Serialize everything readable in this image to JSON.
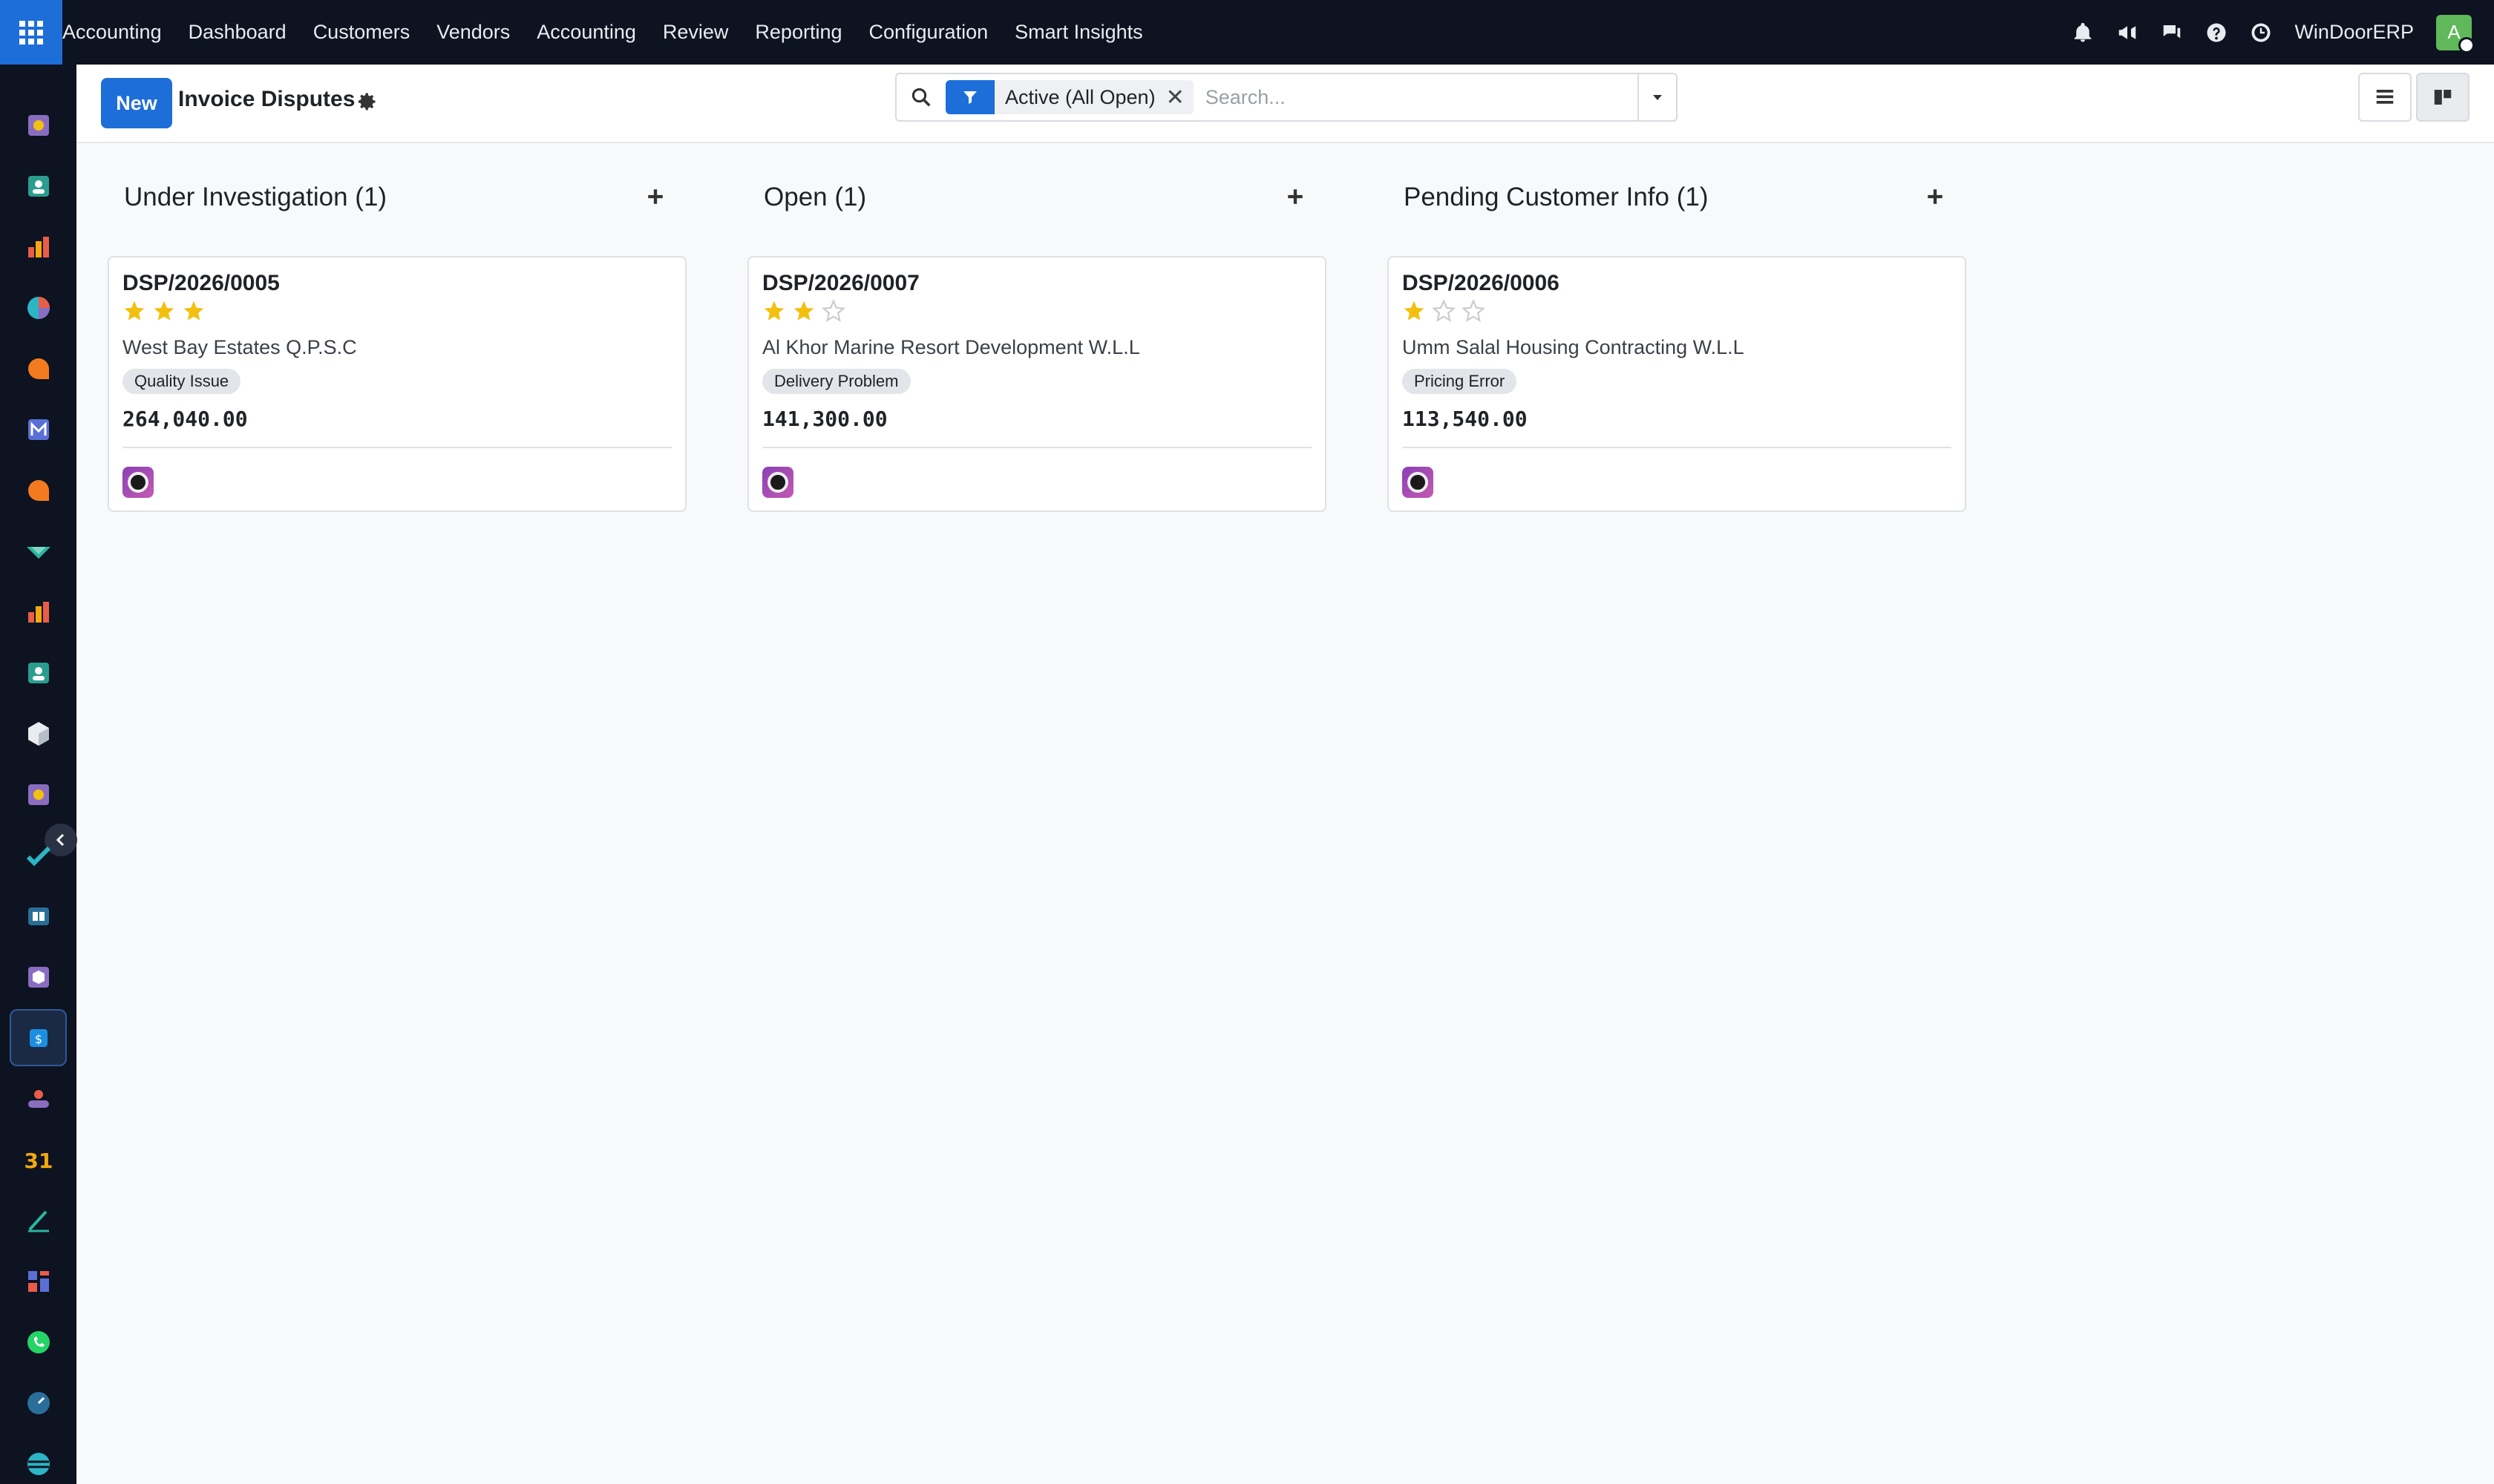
{
  "topbar": {
    "app_name": "Accounting",
    "menu": [
      "Dashboard",
      "Customers",
      "Vendors",
      "Accounting",
      "Review",
      "Reporting",
      "Configuration",
      "Smart Insights"
    ],
    "company": "WinDoorERP",
    "user_initial": "A",
    "icons": [
      "bell-icon",
      "megaphone-icon",
      "chat-icon",
      "help-icon",
      "clock-icon"
    ]
  },
  "sidebar": {
    "icons": [
      "app-icon-1",
      "contacts-icon",
      "reporting-icon",
      "pie-icon",
      "discuss-icon",
      "mail-icon",
      "livechat-icon",
      "check-icon",
      "bar-icon",
      "employees-icon",
      "inventory-icon",
      "app-icon-2",
      "project-icon",
      "knowledge-icon",
      "packages-icon",
      "accounting-icon",
      "team-icon",
      "calendar-icon",
      "sign-icon",
      "dashboard-icon",
      "whatsapp-icon",
      "time-icon",
      "website-icon"
    ],
    "active_index": 15,
    "calendar_label": "31"
  },
  "control_panel": {
    "new_label": "New",
    "title": "Invoice Disputes",
    "facet_label": "Active (All Open)",
    "search_placeholder": "Search..."
  },
  "columns": [
    {
      "header": "Under Investigation (1)",
      "card": {
        "ref": "DSP/2026/0005",
        "stars": 3,
        "partner": "West Bay Estates Q.P.S.C",
        "tag": "Quality Issue",
        "amount": "264,040.00"
      }
    },
    {
      "header": "Open (1)",
      "card": {
        "ref": "DSP/2026/0007",
        "stars": 2,
        "partner": "Al Khor Marine Resort Development W.L.L",
        "tag": "Delivery Problem",
        "amount": "141,300.00"
      }
    },
    {
      "header": "Pending Customer Info (1)",
      "card": {
        "ref": "DSP/2026/0006",
        "stars": 1,
        "partner": "Umm Salal Housing Contracting W.L.L",
        "tag": "Pricing Error",
        "amount": "113,540.00"
      }
    }
  ],
  "colors": {
    "primary": "#1d6ed8",
    "topbar": "#0d1320",
    "star_filled": "#f3c00f",
    "star_empty": "#c7cbd1"
  }
}
